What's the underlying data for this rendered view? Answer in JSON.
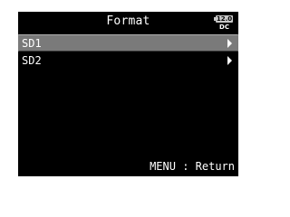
{
  "header": {
    "title": "Format",
    "battery_level": "12.0",
    "power_source": "DC"
  },
  "list": {
    "items": [
      {
        "label": "SD1",
        "selected": true,
        "icon": "chevron-right-icon"
      },
      {
        "label": "SD2",
        "selected": false,
        "icon": "chevron-right-icon"
      }
    ]
  },
  "footer": {
    "hint": "MENU : Return"
  },
  "colors": {
    "background": "#000000",
    "text": "#ffffff",
    "selection": "#7a7a7a",
    "battery": "#c8c8c8"
  }
}
